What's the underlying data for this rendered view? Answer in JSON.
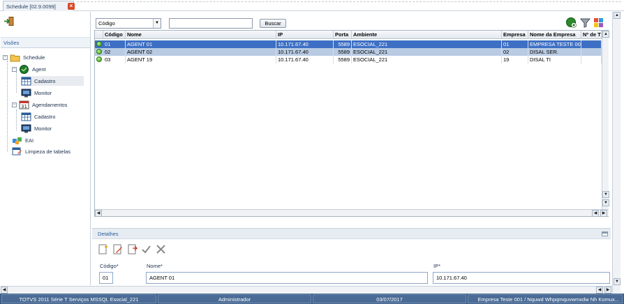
{
  "tab": {
    "title": "Schedule [02.9.0099]"
  },
  "left": {
    "header": "Visões",
    "tree": [
      {
        "label": "Schedule"
      },
      {
        "label": "Agent"
      },
      {
        "label": "Cadastro"
      },
      {
        "label": "Monitor"
      },
      {
        "label": "Agendamentos"
      },
      {
        "label": "Cadastro"
      },
      {
        "label": "Monitor"
      },
      {
        "label": "EAI"
      },
      {
        "label": "Limpeza de tabelas"
      }
    ]
  },
  "toolbar": {
    "filter_select": "Código",
    "search_value": "",
    "search_button": "Buscar"
  },
  "grid": {
    "columns": [
      "Código",
      "Nome",
      "IP",
      "Porta",
      "Ambiente",
      "Empresa",
      "Nome da Empresa",
      "Nº de T"
    ],
    "rows": [
      {
        "codigo": "01",
        "nome": "AGENT 01",
        "ip": "10.171.67.40",
        "porta": "5589",
        "ambiente": "ESOCIAL_221",
        "empresa": "01",
        "nome_empresa": "EMPRESA TESTE 001",
        "n": ""
      },
      {
        "codigo": "02",
        "nome": "AGENT 02",
        "ip": "10.171.67.40",
        "porta": "5589",
        "ambiente": "ESOCIAL_221",
        "empresa": "02",
        "nome_empresa": "DISAL SER.",
        "n": ""
      },
      {
        "codigo": "03",
        "nome": "AGENT 19",
        "ip": "10.171.67.40",
        "porta": "5589",
        "ambiente": "ESOCIAL_221",
        "empresa": "19",
        "nome_empresa": "DISAL TI",
        "n": ""
      }
    ]
  },
  "details": {
    "title": "Detalhes",
    "fields": {
      "codigo_label": "Código*",
      "codigo_value": "01",
      "nome_label": "Nome*",
      "nome_value": "AGENT 01",
      "ip_label": "IP*",
      "ip_value": "10.171.67.40"
    }
  },
  "statusbar": {
    "system": "TOTVS 2011 Série T Serviços MSSQL Esocial_221",
    "user": "Administrador",
    "date": "03/07/2017",
    "company": "Empresa Teste 001 / Nquwd Whpqmquvwmxdw Nh Komux..."
  },
  "colors": {
    "selected_row": "#3d6fc4",
    "statusbar": "#3f5f88"
  }
}
